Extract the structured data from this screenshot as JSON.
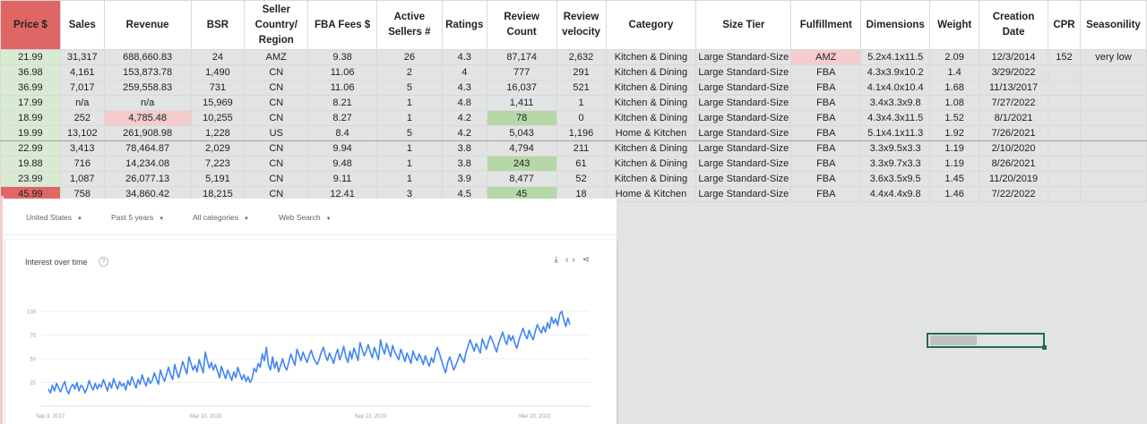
{
  "sheet": {
    "headers": [
      "Price $",
      "Sales",
      "Revenue",
      "BSR",
      "Seller Country/ Region",
      "FBA Fees $",
      "Active Sellers #",
      "Ratings",
      "Review Count",
      "Review velocity",
      "Category",
      "Size Tier",
      "Fulfillment",
      "Dimensions",
      "Weight",
      "Creation Date",
      "CPR",
      "Seasonility"
    ],
    "rows": [
      [
        "21.99",
        "31,317",
        "688,660.83",
        "24",
        "AMZ",
        "9.38",
        "26",
        "4.3",
        "87,174",
        "2,632",
        "Kitchen & Dining",
        "Large Standard-Size",
        "AMZ",
        "5.2x4.1x11.5",
        "2.09",
        "12/3/2014",
        "152",
        "very low"
      ],
      [
        "36.98",
        "4,161",
        "153,873.78",
        "1,490",
        "CN",
        "11.06",
        "2",
        "4",
        "777",
        "291",
        "Kitchen & Dining",
        "Large Standard-Size",
        "FBA",
        "4.3x3.9x10.2",
        "1.4",
        "3/29/2022",
        "",
        ""
      ],
      [
        "36.99",
        "7,017",
        "259,558.83",
        "731",
        "CN",
        "11.06",
        "5",
        "4.3",
        "16,037",
        "521",
        "Kitchen & Dining",
        "Large Standard-Size",
        "FBA",
        "4.1x4.0x10.4",
        "1.68",
        "11/13/2017",
        "",
        ""
      ],
      [
        "17.99",
        "n/a",
        "n/a",
        "15,969",
        "CN",
        "8.21",
        "1",
        "4.8",
        "1,411",
        "1",
        "Kitchen & Dining",
        "Large Standard-Size",
        "FBA",
        "3.4x3.3x9.8",
        "1.08",
        "7/27/2022",
        "",
        ""
      ],
      [
        "18.99",
        "252",
        "4,785.48",
        "10,255",
        "CN",
        "8.27",
        "1",
        "4.2",
        "78",
        "0",
        "Kitchen & Dining",
        "Large Standard-Size",
        "FBA",
        "4.3x4.3x11.5",
        "1.52",
        "8/1/2021",
        "",
        ""
      ],
      [
        "19.99",
        "13,102",
        "261,908.98",
        "1,228",
        "US",
        "8.4",
        "5",
        "4.2",
        "5,043",
        "1,196",
        "Home & Kitchen",
        "Large Standard-Size",
        "FBA",
        "5.1x4.1x11.3",
        "1.92",
        "7/26/2021",
        "",
        ""
      ],
      [
        "22.99",
        "3,413",
        "78,464.87",
        "2,029",
        "CN",
        "9.94",
        "1",
        "3.8",
        "4,794",
        "211",
        "Kitchen & Dining",
        "Large Standard-Size",
        "FBA",
        "3.3x9.5x3.3",
        "1.19",
        "2/10/2020",
        "",
        ""
      ],
      [
        "19.88",
        "716",
        "14,234.08",
        "7,223",
        "CN",
        "9.48",
        "1",
        "3.8",
        "243",
        "61",
        "Kitchen & Dining",
        "Large Standard-Size",
        "FBA",
        "3.3x9.7x3.3",
        "1.19",
        "8/26/2021",
        "",
        ""
      ],
      [
        "23.99",
        "1,087",
        "26,077.13",
        "5,191",
        "CN",
        "9.11",
        "1",
        "3.9",
        "8,477",
        "52",
        "Kitchen & Dining",
        "Large Standard-Size",
        "FBA",
        "3.6x3.5x9.5",
        "1.45",
        "11/20/2019",
        "",
        ""
      ],
      [
        "45.99",
        "758",
        "34,860.42",
        "18,215",
        "CN",
        "12.41",
        "3",
        "4.5",
        "45",
        "18",
        "Home & Kitchen",
        "Large Standard-Size",
        "FBA",
        "4.4x4.4x9.8",
        "1.46",
        "7/22/2022",
        "",
        ""
      ]
    ],
    "colors": {
      "price_green": "#d9ead3",
      "price_red": "#e06666",
      "revenue_pink": "#f4cccc",
      "review_green": "#b6d7a8",
      "fulfillment_amz": "#f4cccc",
      "selection": "#1e7145"
    }
  },
  "trends": {
    "filters": [
      "United States",
      "Past 5 years",
      "All categories",
      "Web Search"
    ],
    "card_title": "Interest over time",
    "help_icon": "help-circle-icon",
    "actions": [
      "download-icon",
      "embed-code-icon",
      "share-icon"
    ],
    "chart_data": {
      "type": "line",
      "title": "Interest over time",
      "yticks": [
        25,
        50,
        75,
        100
      ],
      "ylim": [
        0,
        100
      ],
      "xticks": [
        "Sep 3, 2017",
        "Mar 10, 2019",
        "Sep 13, 2020",
        "Mar 20, 2022"
      ],
      "series": [
        {
          "color": "#4285f4",
          "values": [
            18,
            14,
            22,
            16,
            24,
            19,
            15,
            21,
            26,
            17,
            13,
            20,
            23,
            18,
            25,
            16,
            22,
            20,
            14,
            19,
            27,
            21,
            17,
            24,
            18,
            23,
            20,
            28,
            22,
            16,
            25,
            19,
            29,
            23,
            18,
            26,
            21,
            24,
            17,
            27,
            22,
            31,
            25,
            19,
            28,
            23,
            33,
            26,
            21,
            30,
            24,
            27,
            35,
            29,
            23,
            38,
            31,
            26,
            34,
            41,
            33,
            28,
            44,
            36,
            30,
            39,
            47,
            40,
            34,
            52,
            45,
            38,
            43,
            36,
            49,
            42,
            35,
            57,
            48,
            40,
            46,
            38,
            44,
            37,
            30,
            42,
            35,
            29,
            38,
            33,
            27,
            36,
            30,
            41,
            34,
            28,
            33,
            26,
            31,
            25,
            29,
            40,
            36,
            45,
            41,
            55,
            48,
            62,
            44,
            38,
            52,
            40,
            47,
            36,
            43,
            50,
            42,
            38,
            46,
            55,
            49,
            43,
            60,
            54,
            48,
            57,
            51,
            46,
            53,
            59,
            52,
            47,
            44,
            50,
            57,
            62,
            53,
            48,
            56,
            51,
            45,
            54,
            60,
            49,
            55,
            63,
            52,
            46,
            58,
            50,
            61,
            55,
            48,
            67,
            60,
            53,
            58,
            65,
            57,
            51,
            62,
            56,
            49,
            70,
            61,
            55,
            66,
            59,
            52,
            64,
            57,
            53,
            49,
            60,
            54,
            47,
            56,
            51,
            45,
            58,
            52,
            48,
            55,
            50,
            44,
            53,
            47,
            42,
            51,
            46,
            57,
            62,
            55,
            48,
            41,
            35,
            46,
            52,
            45,
            38,
            43,
            49,
            55,
            50,
            46,
            57,
            63,
            70,
            64,
            58,
            66,
            61,
            56,
            71,
            65,
            60,
            68,
            74,
            69,
            63,
            57,
            66,
            72,
            78,
            70,
            65,
            75,
            69,
            74,
            66,
            61,
            70,
            76,
            82,
            75,
            71,
            80,
            74,
            70,
            79,
            86,
            81,
            77,
            84,
            78,
            88,
            82,
            94,
            87,
            92,
            85,
            97,
            100,
            91,
            84,
            93,
            86
          ]
        }
      ]
    }
  }
}
